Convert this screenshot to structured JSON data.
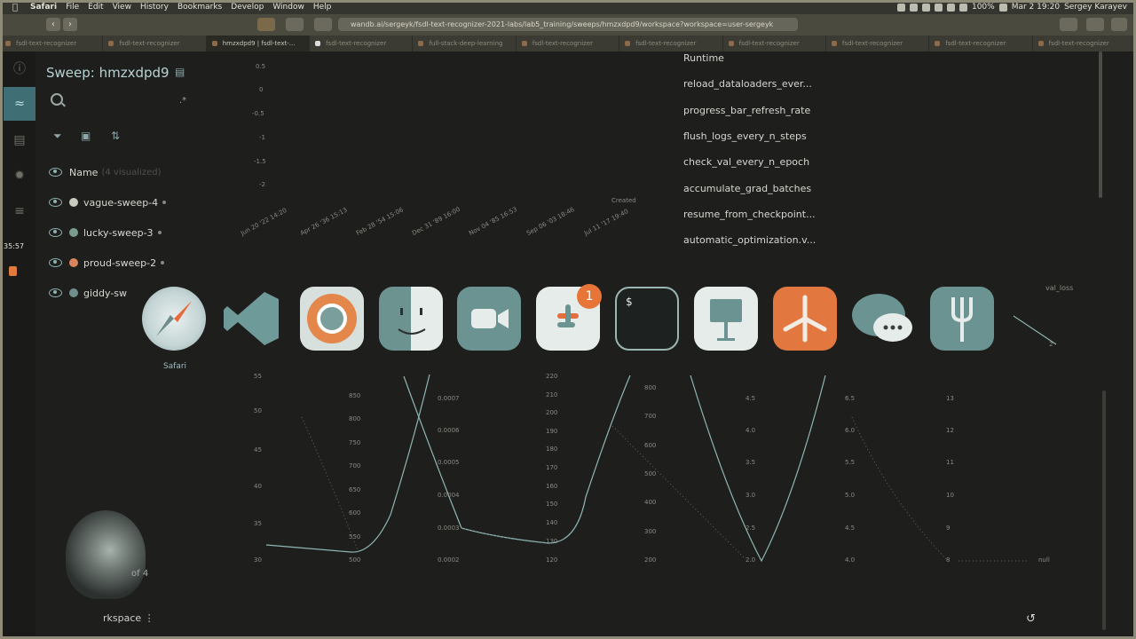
{
  "menubar": {
    "app": "Safari",
    "items": [
      "File",
      "Edit",
      "View",
      "History",
      "Bookmarks",
      "Develop",
      "Window",
      "Help"
    ],
    "battery": "100%",
    "datetime": "Mar 2  19:20",
    "user": "Sergey Karayev"
  },
  "browser": {
    "url": "wandb.ai/sergeyk/fsdl-text-recognizer-2021-labs/lab5_training/sweeps/hmzxdpd9/workspace?workspace=user-sergeyk",
    "tabs": [
      "fsdl-text-recognizer",
      "fsdl-text-recognizer",
      "hmzxdpd9 | fsdl-text-...",
      "fsdl-text-recognizer",
      "full-stack-deep-learning",
      "fsdl-text-recognizer",
      "fsdl-text-recognizer",
      "fsdl-text-recognizer",
      "fsdl-text-recognizer",
      "fsdl-text-recognizer",
      "fsdl-text-recognizer"
    ]
  },
  "sidebar": {
    "timer": "35:57",
    "title": "Sweep: hmzxdpd9",
    "name_header": "Name",
    "name_count": "(4 visualized)",
    "runs": [
      {
        "name": "vague-sweep-4",
        "color": "#c9c9bf"
      },
      {
        "name": "lucky-sweep-3",
        "color": "#7a9b8d"
      },
      {
        "name": "proud-sweep-2",
        "color": "#d9845b"
      },
      {
        "name": "giddy-sw",
        "color": "#6f8f8f"
      }
    ],
    "pagination": "of 4",
    "workspace": "rkspace"
  },
  "top_chart": {
    "y_ticks": [
      "0.5",
      "0",
      "-0.5",
      "-1",
      "-1.5",
      "-2"
    ],
    "x_label": "Created",
    "x_ticks": [
      "Jun 20 '22 14:20",
      "Apr 26 '36 15:13",
      "Feb 28 '54 15:06",
      "Dec 31 '89 16:00",
      "Nov 04 '85 16:53",
      "Sep 06 '03 18:46",
      "Jul 11 '17 19:40"
    ]
  },
  "config_params": [
    "Runtime",
    "reload_dataloaders_ever...",
    "progress_bar_refresh_rate",
    "flush_logs_every_n_steps",
    "check_val_every_n_epoch",
    "accumulate_grad_batches",
    "resume_from_checkpoint...",
    "automatic_optimization.v..."
  ],
  "parallel": {
    "val_loss_label": "val_loss",
    "val_loss_tick": "2",
    "axes": [
      {
        "ticks": [
          "55",
          "50",
          "45",
          "40",
          "35",
          "30"
        ]
      },
      {
        "ticks": [
          "850",
          "800",
          "750",
          "700",
          "650",
          "600",
          "550",
          "500"
        ]
      },
      {
        "ticks": [
          "0.0007",
          "0.0006",
          "0.0005",
          "0.0004",
          "0.0003",
          "0.0002"
        ]
      },
      {
        "ticks": [
          "220",
          "210",
          "200",
          "190",
          "180",
          "170",
          "160",
          "150",
          "140",
          "130",
          "120"
        ]
      },
      {
        "ticks": [
          "800",
          "700",
          "600",
          "500",
          "400",
          "300",
          "200"
        ]
      },
      {
        "ticks": [
          "4.5",
          "4.0",
          "3.5",
          "3.0",
          "2.5",
          "2.0"
        ]
      },
      {
        "ticks": [
          "6.5",
          "6.0",
          "5.5",
          "5.0",
          "4.5",
          "4.0"
        ]
      },
      {
        "ticks": [
          "13",
          "12",
          "11",
          "10",
          "9",
          "8"
        ]
      }
    ],
    "last_tick": "null"
  },
  "dock": {
    "tooltip": "Safari",
    "slack_badge": "1",
    "terminal_prompt": "$",
    "apps": [
      "safari-icon",
      "vscode-icon",
      "chrome-icon",
      "finder-icon",
      "zoom-icon",
      "slack-icon",
      "terminal-icon",
      "keynote-icon",
      "pin-icon",
      "messages-icon",
      "fork-icon"
    ]
  }
}
